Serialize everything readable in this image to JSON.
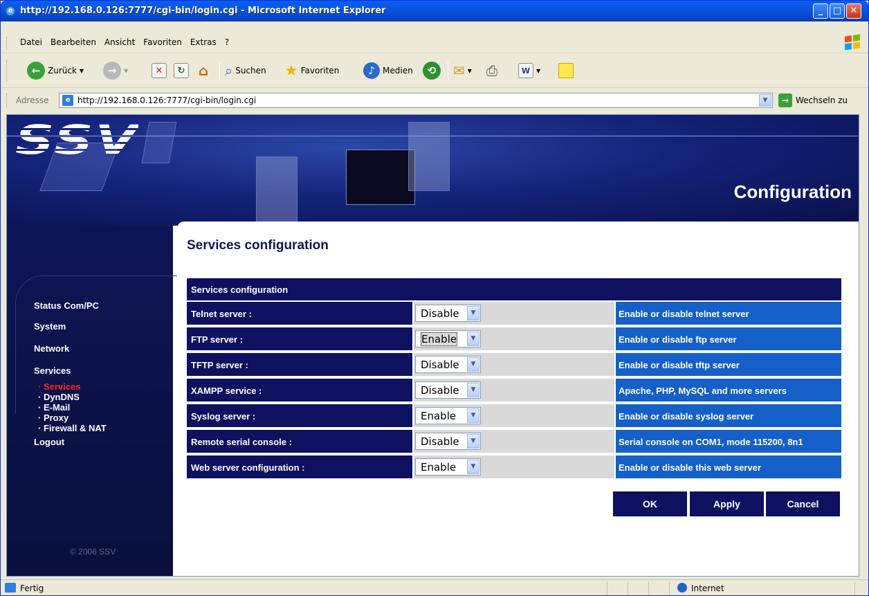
{
  "window": {
    "title": "http://192.168.0.126:7777/cgi-bin/login.cgi - Microsoft Internet Explorer"
  },
  "menu": [
    "Datei",
    "Bearbeiten",
    "Ansicht",
    "Favoriten",
    "Extras",
    "?"
  ],
  "toolbar": {
    "back": "Zurück",
    "search": "Suchen",
    "favorites": "Favoriten",
    "media": "Medien"
  },
  "address": {
    "label": "Adresse",
    "url": "http://192.168.0.126:7777/cgi-bin/login.cgi",
    "go": "Wechseln zu"
  },
  "banner": {
    "logo": "SSV",
    "section": "Configuration"
  },
  "sidebar": {
    "main": [
      "Status Com/PC",
      "System",
      "Network",
      "Services"
    ],
    "sub": [
      "· Services",
      "· DynDNS",
      "· E-Mail",
      "· Proxy",
      "· Firewall & NAT"
    ],
    "logout": "Logout",
    "copyright": "© 2006 SSV",
    "active_color": "#ff2020"
  },
  "page": {
    "title": "Services configuration",
    "table_header": "Services configuration"
  },
  "rows": [
    {
      "label": "Telnet server :",
      "value": "Disable",
      "desc": "Enable or disable telnet server"
    },
    {
      "label": "FTP server :",
      "value": "Enable",
      "desc": "Enable or disable ftp server"
    },
    {
      "label": "TFTP server :",
      "value": "Disable",
      "desc": "Enable or disable tftp server"
    },
    {
      "label": "XAMPP service :",
      "value": "Disable",
      "desc": "Apache, PHP, MySQL and more servers"
    },
    {
      "label": "Syslog server :",
      "value": "Enable",
      "desc": "Enable or disable syslog server"
    },
    {
      "label": "Remote serial console :",
      "value": "Disable",
      "desc": "Serial console on COM1, mode 115200, 8n1"
    },
    {
      "label": "Web server configuration :",
      "value": "Enable",
      "desc": "Enable or disable this web server"
    }
  ],
  "buttons": {
    "ok": "OK",
    "apply": "Apply",
    "cancel": "Cancel"
  },
  "status": {
    "left": "Fertig",
    "zone": "Internet"
  },
  "colors": {
    "nav_dark": "#0d1160",
    "desc_blue": "#1560c8",
    "title_blue": "#0d1659"
  }
}
